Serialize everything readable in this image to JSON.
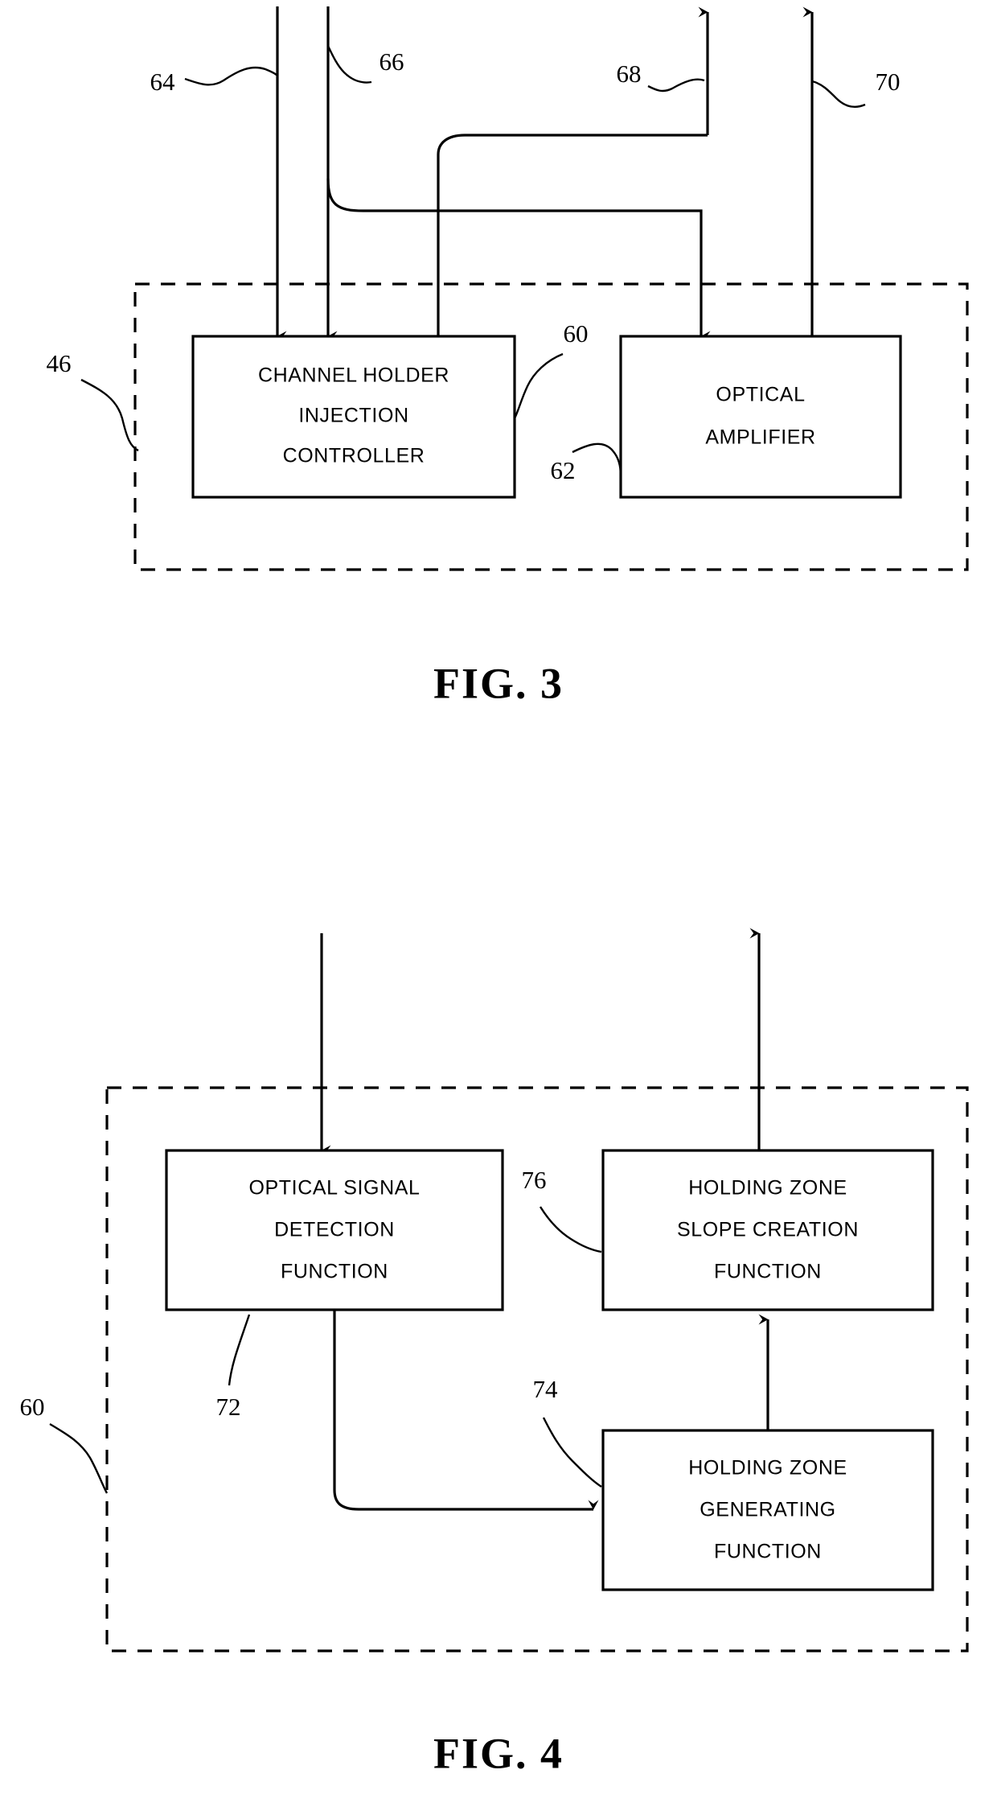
{
  "page": {
    "type": "patent-drawing-sheet",
    "background_color": "#ffffff",
    "ink_color": "#000000"
  },
  "figures": [
    {
      "id": "fig3",
      "caption": "FIG. 3",
      "enclosure_ref": "46",
      "boxes": [
        {
          "id": "channel-holder-injection-controller",
          "ref": "60",
          "lines": [
            "CHANNEL HOLDER",
            "INJECTION",
            "CONTROLLER"
          ]
        },
        {
          "id": "optical-amplifier",
          "ref": "62",
          "lines": [
            "OPTICAL",
            "AMPLIFIER"
          ]
        }
      ],
      "signal_refs": [
        {
          "id": "64",
          "label": "64",
          "direction": "in"
        },
        {
          "id": "66",
          "label": "66",
          "direction": "in"
        },
        {
          "id": "68",
          "label": "68",
          "direction": "out"
        },
        {
          "id": "70",
          "label": "70",
          "direction": "out"
        }
      ]
    },
    {
      "id": "fig4",
      "caption": "FIG. 4",
      "enclosure_ref": "60",
      "boxes": [
        {
          "id": "optical-signal-detection-function",
          "ref": "72",
          "lines": [
            "OPTICAL SIGNAL",
            "DETECTION",
            "FUNCTION"
          ]
        },
        {
          "id": "holding-zone-slope-creation-function",
          "ref": "76",
          "lines": [
            "HOLDING ZONE",
            "SLOPE CREATION",
            "FUNCTION"
          ]
        },
        {
          "id": "holding-zone-generating-function",
          "ref": "74",
          "lines": [
            "HOLDING ZONE",
            "GENERATING",
            "FUNCTION"
          ]
        }
      ]
    }
  ],
  "labels": {
    "ref_46": "46",
    "ref_60_fig3": "60",
    "ref_62": "62",
    "ref_64": "64",
    "ref_66": "66",
    "ref_68": "68",
    "ref_70": "70",
    "ref_60_fig4": "60",
    "ref_72": "72",
    "ref_74": "74",
    "ref_76": "76",
    "fig3_caption": "FIG. 3",
    "fig4_caption": "FIG. 4",
    "b1_l1": "CHANNEL HOLDER",
    "b1_l2": "INJECTION",
    "b1_l3": "CONTROLLER",
    "b2_l1": "OPTICAL",
    "b2_l2": "AMPLIFIER",
    "b3_l1": "OPTICAL SIGNAL",
    "b3_l2": "DETECTION",
    "b3_l3": "FUNCTION",
    "b4_l1": "HOLDING ZONE",
    "b4_l2": "SLOPE CREATION",
    "b4_l3": "FUNCTION",
    "b5_l1": "HOLDING ZONE",
    "b5_l2": "GENERATING",
    "b5_l3": "FUNCTION"
  }
}
